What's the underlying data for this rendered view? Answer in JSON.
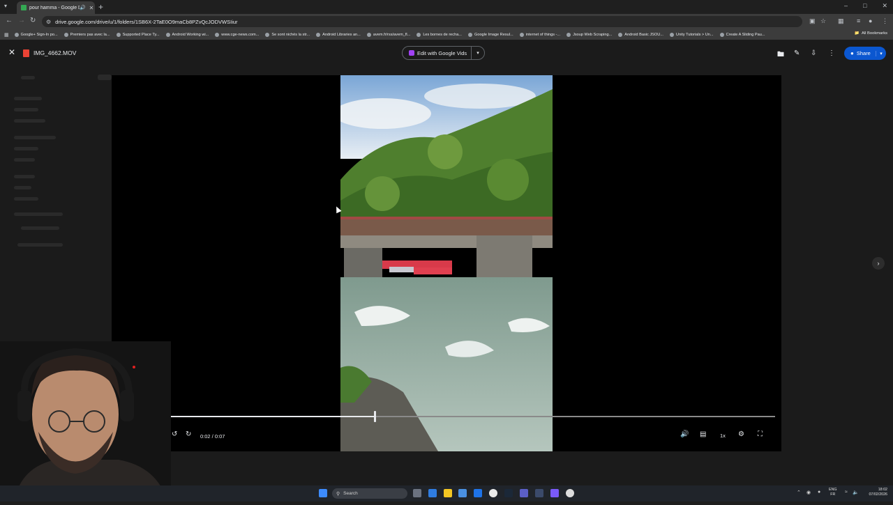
{
  "browser": {
    "tab_title": "pour hamma - Google Drive",
    "url": "drive.google.com/drive/u/1/folders/1SB6X-2TaE0O9maCb8PZvQcJODVWSIiur",
    "bookmarks": [
      "Google+ Sign-In po...",
      "Premiers pas avec la...",
      "Supported Place Ty...",
      "Android Working wi...",
      "www.cge-news.com...",
      "Se sont nichés la str...",
      "Android Libraries an...",
      "avem.fr/rss/avem_fl...",
      "Les bornes de recha...",
      "Google Image Resul...",
      "internet of things -...",
      "Jsoup Web Scraping...",
      "Android Basic JSOU...",
      "Unity Tutorials > Un...",
      "Create A Sliding Pau..."
    ],
    "all_bookmarks": "All Bookmarks"
  },
  "viewer": {
    "filename": "IMG_4662.MOV",
    "edit_button": "Edit with Google Vids",
    "share_button": "Share"
  },
  "player": {
    "time": "0:02 / 0:07",
    "speed": "1x",
    "progress": 0.375
  },
  "taskbar": {
    "search_label": "Search",
    "lang_line1": "ENG",
    "lang_line2": "FR",
    "time": "18:02",
    "date": "07/02/2026"
  },
  "colors": {
    "share_blue": "#0b57d0",
    "vids_purple": "#a142f4",
    "file_red": "#ea4335"
  }
}
